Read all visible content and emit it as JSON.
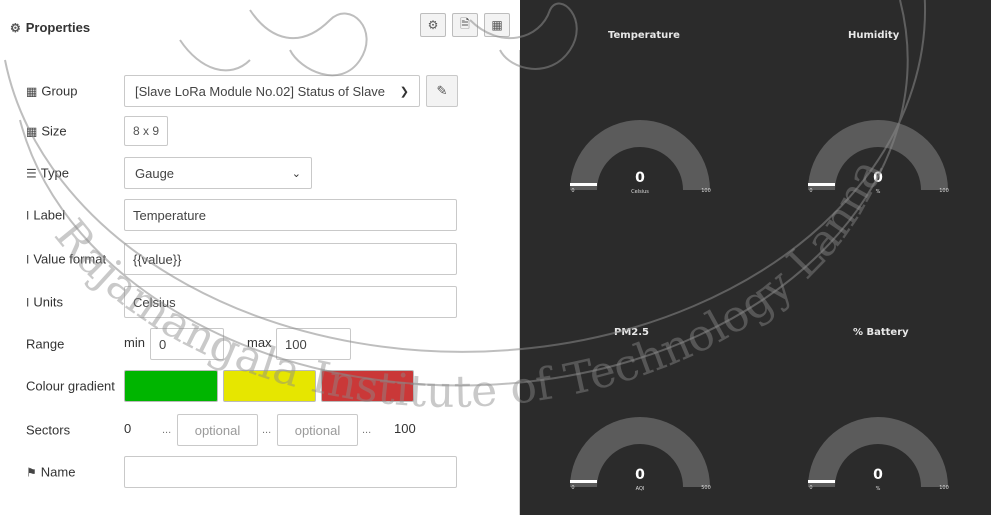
{
  "header": {
    "title": "Properties",
    "icons": [
      "gear-icon",
      "description-icon",
      "layout-icon"
    ]
  },
  "fields": {
    "group": {
      "label": "Group",
      "value": "[Slave LoRa Module No.02] Status of Slave"
    },
    "size": {
      "label": "Size",
      "value": "8 x 9"
    },
    "type": {
      "label": "Type",
      "value": "Gauge"
    },
    "label": {
      "label": "Label",
      "value": "Temperature"
    },
    "value_format": {
      "label": "Value format",
      "value": "{{value}}"
    },
    "units": {
      "label": "Units",
      "value": "Celsius"
    },
    "range": {
      "label": "Range",
      "min_label": "min",
      "min_value": "0",
      "max_label": "max",
      "max_value": "100"
    },
    "colour_gradient": {
      "label": "Colour gradient",
      "colors": [
        "#00b500",
        "#e6e600",
        "#ca3838"
      ]
    },
    "sectors": {
      "label": "Sectors",
      "start": "0",
      "ellipsis": "...",
      "placeholder1": "optional",
      "placeholder2": "optional",
      "end": "100"
    },
    "name": {
      "label": "Name",
      "value": ""
    }
  },
  "dashboard": {
    "gauges": [
      {
        "title": "Temperature",
        "value": "0",
        "units": "Celsius",
        "min": "0",
        "max": "100"
      },
      {
        "title": "Humidity",
        "value": "0",
        "units": "%",
        "min": "0",
        "max": "100"
      },
      {
        "title": "PM2.5",
        "value": "0",
        "units": "AQI",
        "min": "0",
        "max": "500"
      },
      {
        "title": "% Battery",
        "value": "0",
        "units": "%",
        "min": "0",
        "max": "100"
      }
    ]
  },
  "watermark": {
    "text": "Rajamangala Institute of Technology Lanna",
    "color": "#8a8a8a"
  },
  "colors": {
    "dashboard_bg": "#2b2b2b",
    "gauge_track": "#5b5b5b",
    "gauge_text": "#ffffff"
  }
}
